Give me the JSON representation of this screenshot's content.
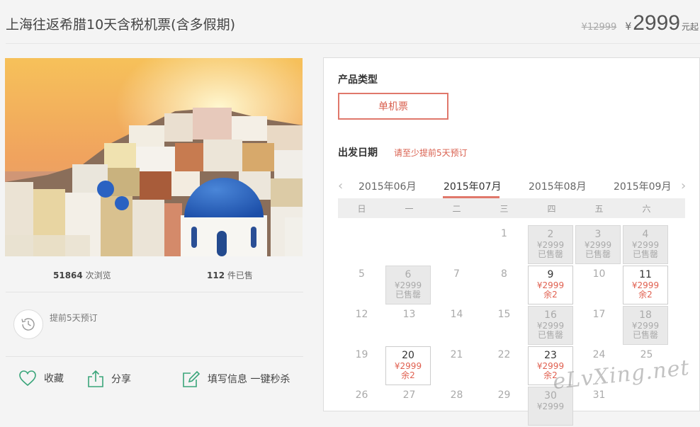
{
  "header": {
    "title": "上海往返希腊10天含税机票(含多假期)",
    "original_price": "¥12999",
    "currency_symbol": "¥",
    "current_price": "2999",
    "price_unit": "元起"
  },
  "stats": {
    "views_count": "51864",
    "views_label": "次浏览",
    "sold_count": "112",
    "sold_label": "件已售"
  },
  "advance_booking": {
    "icon": "clock-history-icon",
    "text": "提前5天预订"
  },
  "actions": {
    "favorite": "收藏",
    "share": "分享",
    "fill_info": "填写信息 一键秒杀"
  },
  "product": {
    "type_label": "产品类型",
    "type_option": "单机票",
    "date_label": "出发日期",
    "date_note": "请至少提前5天预订"
  },
  "calendar": {
    "months": [
      "2015年06月",
      "2015年07月",
      "2015年08月",
      "2015年09月"
    ],
    "active_month": "2015年07月",
    "weekdays": [
      "日",
      "一",
      "二",
      "三",
      "四",
      "五",
      "六"
    ],
    "cells": [
      {
        "day": ""
      },
      {
        "day": ""
      },
      {
        "day": ""
      },
      {
        "day": "1"
      },
      {
        "day": "2",
        "price": "¥2999",
        "status": "已售罄"
      },
      {
        "day": "3",
        "price": "¥2999",
        "status": "已售罄"
      },
      {
        "day": "4",
        "price": "¥2999",
        "status": "已售罄"
      },
      {
        "day": "5"
      },
      {
        "day": "6",
        "price": "¥2999",
        "status": "已售罄"
      },
      {
        "day": "7"
      },
      {
        "day": "8"
      },
      {
        "day": "9",
        "price": "¥2999",
        "status": "余2",
        "available": true
      },
      {
        "day": "10"
      },
      {
        "day": "11",
        "price": "¥2999",
        "status": "余2",
        "available": true
      },
      {
        "day": "12"
      },
      {
        "day": "13"
      },
      {
        "day": "14"
      },
      {
        "day": "15"
      },
      {
        "day": "16",
        "price": "¥2999",
        "status": "已售罄"
      },
      {
        "day": "17"
      },
      {
        "day": "18",
        "price": "¥2999",
        "status": "已售罄"
      },
      {
        "day": "19"
      },
      {
        "day": "20",
        "price": "¥2999",
        "status": "余2",
        "available": true
      },
      {
        "day": "21"
      },
      {
        "day": "22"
      },
      {
        "day": "23",
        "price": "¥2999",
        "status": "余2",
        "available": true
      },
      {
        "day": "24"
      },
      {
        "day": "25"
      },
      {
        "day": "26"
      },
      {
        "day": "27"
      },
      {
        "day": "28"
      },
      {
        "day": "29"
      },
      {
        "day": "30",
        "price": "¥2999",
        "status": ""
      },
      {
        "day": "31"
      }
    ]
  },
  "watermark": "eLvXing.net",
  "colors": {
    "accent": "#e0786b",
    "price_red": "#e06050",
    "green_icon": "#3aa57a"
  }
}
